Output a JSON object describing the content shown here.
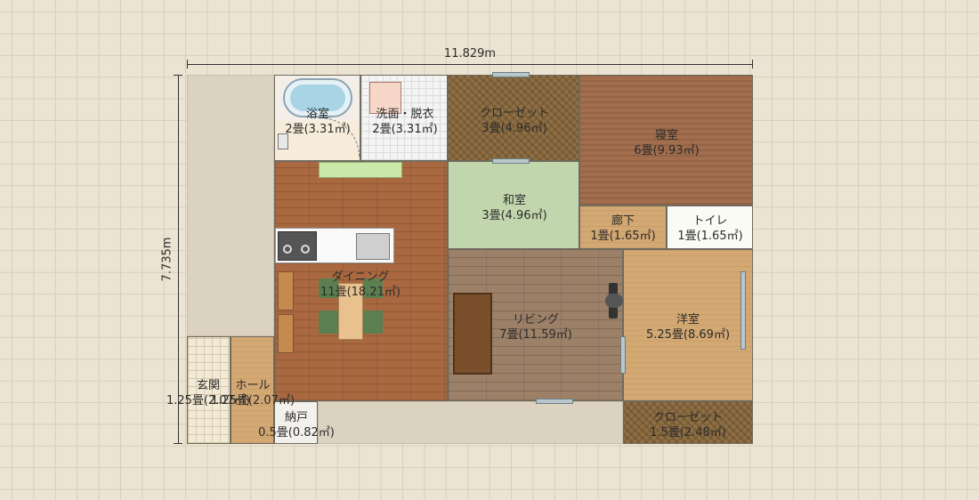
{
  "plan": {
    "width_dim": "11.829m",
    "height_dim": "7.735m"
  },
  "rooms": {
    "bath": {
      "name": "浴室",
      "area": "2畳(3.31㎡)"
    },
    "washroom": {
      "name": "洗面・脱衣",
      "area": "2畳(3.31㎡)"
    },
    "closet_north": {
      "name": "クローゼット",
      "area": "3畳(4.96㎡)"
    },
    "bedroom": {
      "name": "寝室",
      "area": "6畳(9.93㎡)"
    },
    "washitsu": {
      "name": "和室",
      "area": "3畳(4.96㎡)"
    },
    "hallway": {
      "name": "廊下",
      "area": "1畳(1.65㎡)"
    },
    "toilet": {
      "name": "トイレ",
      "area": "1畳(1.65㎡)"
    },
    "dining": {
      "name": "ダイニング",
      "area": "11畳(18.21㎡)"
    },
    "living": {
      "name": "リビング",
      "area": "7畳(11.59㎡)"
    },
    "western": {
      "name": "洋室",
      "area": "5.25畳(8.69㎡)"
    },
    "closet_south": {
      "name": "クローゼット",
      "area": "1.5畳(2.48㎡)"
    },
    "genkan": {
      "name": "玄関",
      "area": "1.25畳(2.07㎡)"
    },
    "hall": {
      "name": "ホール",
      "area": "1.25畳(2.07㎡)"
    },
    "nando": {
      "name": "納戸",
      "area": "0.5畳(0.82㎡)"
    }
  },
  "colors": {
    "dining_floor": "#a9683f",
    "bedroom_floor": "#a36e4d",
    "tatami": "#c2d6ad",
    "closet": "#8f6f43",
    "living_floor": "#9c8068"
  }
}
